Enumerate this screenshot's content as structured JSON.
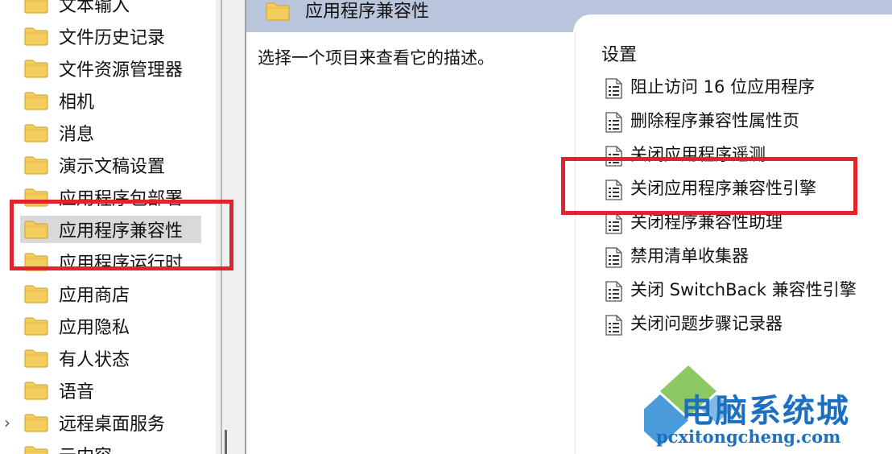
{
  "left_tree": {
    "items": [
      {
        "label": "文本输入",
        "selected": false,
        "expander": ""
      },
      {
        "label": "文件历史记录",
        "selected": false,
        "expander": ""
      },
      {
        "label": "文件资源管理器",
        "selected": false,
        "expander": ""
      },
      {
        "label": "相机",
        "selected": false,
        "expander": ""
      },
      {
        "label": "消息",
        "selected": false,
        "expander": ""
      },
      {
        "label": "演示文稿设置",
        "selected": false,
        "expander": ""
      },
      {
        "label": "应用程序包部署",
        "selected": false,
        "expander": ""
      },
      {
        "label": "应用程序兼容性",
        "selected": true,
        "expander": ""
      },
      {
        "label": "应用程序运行时",
        "selected": false,
        "expander": ""
      },
      {
        "label": "应用商店",
        "selected": false,
        "expander": ""
      },
      {
        "label": "应用隐私",
        "selected": false,
        "expander": ""
      },
      {
        "label": "有人状态",
        "selected": false,
        "expander": ""
      },
      {
        "label": "语音",
        "selected": false,
        "expander": ""
      },
      {
        "label": "远程桌面服务",
        "selected": false,
        "expander": "›"
      },
      {
        "label": "云内容",
        "selected": false,
        "expander": ""
      }
    ]
  },
  "right_pane": {
    "title": "应用程序兼容性",
    "description_prompt": "选择一个项目来查看它的描述。",
    "column_header": "设置",
    "settings": [
      {
        "label": "阻止访问 16 位应用程序"
      },
      {
        "label": "删除程序兼容性属性页"
      },
      {
        "label": "关闭应用程序遥测"
      },
      {
        "label": "关闭应用程序兼容性引擎"
      },
      {
        "label": "关闭程序兼容性助理"
      },
      {
        "label": "禁用清单收集器"
      },
      {
        "label": "关闭 SwitchBack 兼容性引擎"
      },
      {
        "label": "关闭问题步骤记录器"
      }
    ]
  },
  "watermark": {
    "title": "电脑系统城",
    "url": "pcxitongcheng.com"
  },
  "colors": {
    "header_band": "#b8c5da",
    "selection": "#d9d9d9",
    "highlight_red": "#e0242b",
    "folder_yellow": "#f4cd5f",
    "watermark_blue": "#1d6fc0"
  },
  "icons": {
    "folder": "folder-icon",
    "setting": "policy-setting-icon",
    "expander": "chevron-right-icon"
  }
}
